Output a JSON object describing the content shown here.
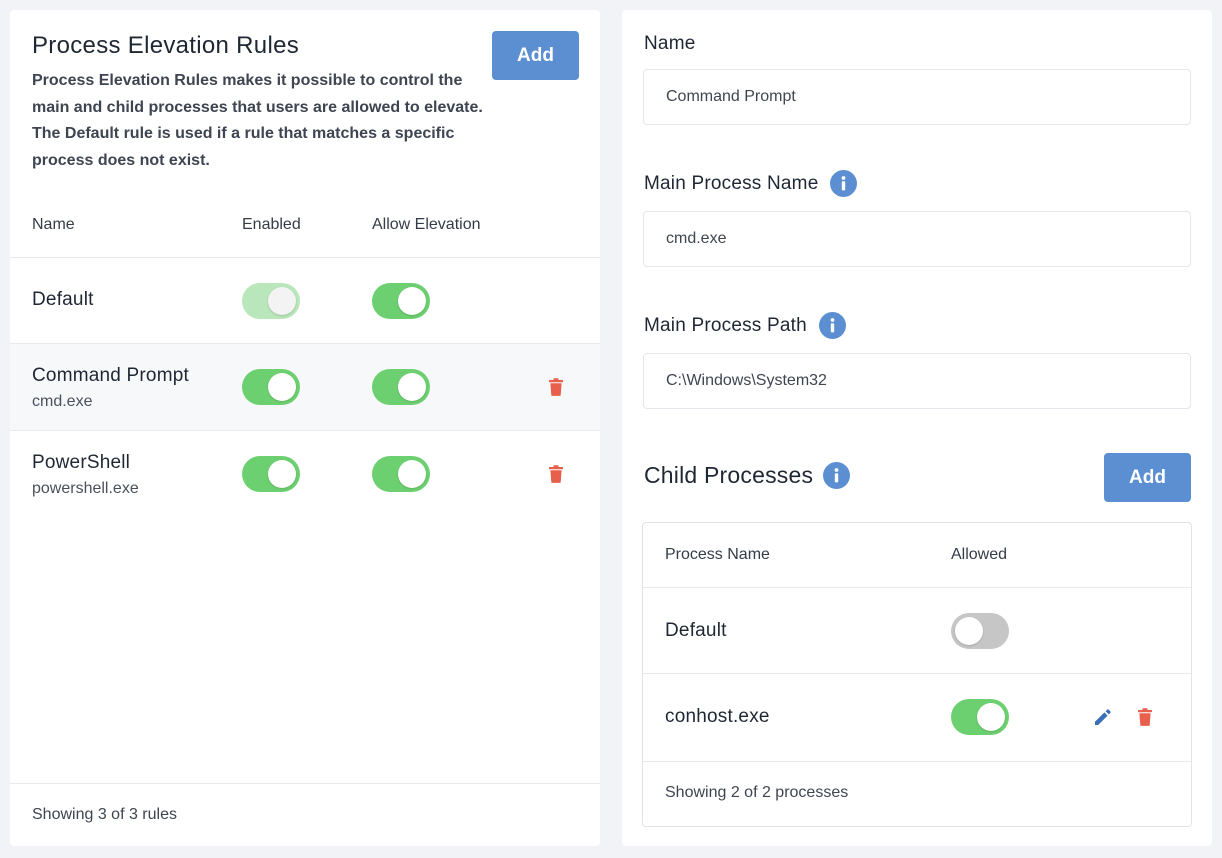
{
  "rules_panel": {
    "title": "Process Elevation Rules",
    "description": "Process Elevation Rules makes it possible to control the main and child processes that users are allowed to elevate. The Default rule is used if a rule that matches a specific process does not exist.",
    "add_label": "Add",
    "columns": {
      "name": "Name",
      "enabled": "Enabled",
      "allow_elevation": "Allow Elevation"
    },
    "rows": [
      {
        "name": "Default",
        "process": "",
        "enabled": true,
        "enabled_locked": true,
        "allow_elevation": true,
        "deletable": false
      },
      {
        "name": "Command Prompt",
        "process": "cmd.exe",
        "enabled": true,
        "enabled_locked": false,
        "allow_elevation": true,
        "deletable": true
      },
      {
        "name": "PowerShell",
        "process": "powershell.exe",
        "enabled": true,
        "enabled_locked": false,
        "allow_elevation": true,
        "deletable": true
      }
    ],
    "footer": "Showing 3 of 3 rules"
  },
  "detail_panel": {
    "name_label": "Name",
    "name_value": "Command Prompt",
    "main_process_name_label": "Main Process Name",
    "main_process_name_value": "cmd.exe",
    "main_process_path_label": "Main Process Path",
    "main_process_path_value": "C:\\Windows\\System32",
    "child_processes_title": "Child Processes",
    "add_label": "Add",
    "columns": {
      "process_name": "Process Name",
      "allowed": "Allowed"
    },
    "rows": [
      {
        "name": "Default",
        "allowed": false
      },
      {
        "name": "conhost.exe",
        "allowed": true
      }
    ],
    "footer": "Showing 2 of 2 processes"
  },
  "colors": {
    "accent": "#5b8fd1",
    "toggle_on": "#6dd070",
    "toggle_off": "#c6c6c6",
    "danger": "#e8604c",
    "edit": "#3a6fb8"
  },
  "icons": {
    "info": "info-icon",
    "trash": "trash-icon",
    "edit": "pencil-icon"
  }
}
